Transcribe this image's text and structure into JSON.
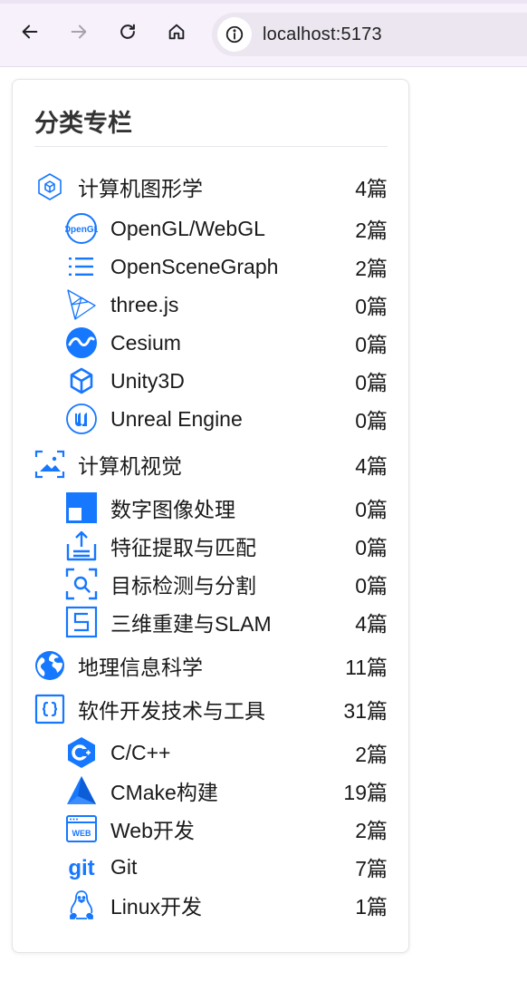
{
  "browser": {
    "url": "localhost:5173",
    "icons": [
      "back-arrow-icon",
      "forward-arrow-icon",
      "reload-icon",
      "home-icon",
      "info-icon"
    ]
  },
  "card": {
    "title": "分类专栏",
    "accent_color": "#1677ff",
    "categories": [
      {
        "label": "计算机图形学",
        "count": "4篇",
        "icon": "graphics-cube-icon",
        "children": [
          {
            "label": "OpenGL/WebGL",
            "count": "2篇",
            "icon": "opengl-logo-icon"
          },
          {
            "label": "OpenSceneGraph",
            "count": "2篇",
            "icon": "list-icon"
          },
          {
            "label": "three.js",
            "count": "0篇",
            "icon": "threejs-logo-icon"
          },
          {
            "label": "Cesium",
            "count": "0篇",
            "icon": "cesium-logo-icon"
          },
          {
            "label": "Unity3D",
            "count": "0篇",
            "icon": "unity-logo-icon"
          },
          {
            "label": "Unreal Engine",
            "count": "0篇",
            "icon": "unreal-logo-icon"
          }
        ]
      },
      {
        "label": "计算机视觉",
        "count": "4篇",
        "icon": "image-scan-icon",
        "children": [
          {
            "label": "数字图像处理",
            "count": "0篇",
            "icon": "image-block-icon"
          },
          {
            "label": "特征提取与匹配",
            "count": "0篇",
            "icon": "upload-tray-icon"
          },
          {
            "label": "目标检测与分割",
            "count": "0篇",
            "icon": "scan-search-icon"
          },
          {
            "label": "三维重建与SLAM",
            "count": "4篇",
            "icon": "slam-s-icon"
          }
        ]
      },
      {
        "label": "地理信息科学",
        "count": "11篇",
        "icon": "globe-icon",
        "children": []
      },
      {
        "label": "软件开发技术与工具",
        "count": "31篇",
        "icon": "code-braces-icon",
        "children": [
          {
            "label": "C/C++",
            "count": "2篇",
            "icon": "cpp-logo-icon"
          },
          {
            "label": "CMake构建",
            "count": "19篇",
            "icon": "cmake-logo-icon"
          },
          {
            "label": "Web开发",
            "count": "2篇",
            "icon": "web-browser-icon"
          },
          {
            "label": "Git",
            "count": "7篇",
            "icon": "git-logo-icon"
          },
          {
            "label": "Linux开发",
            "count": "1篇",
            "icon": "linux-penguin-icon"
          }
        ]
      }
    ]
  }
}
